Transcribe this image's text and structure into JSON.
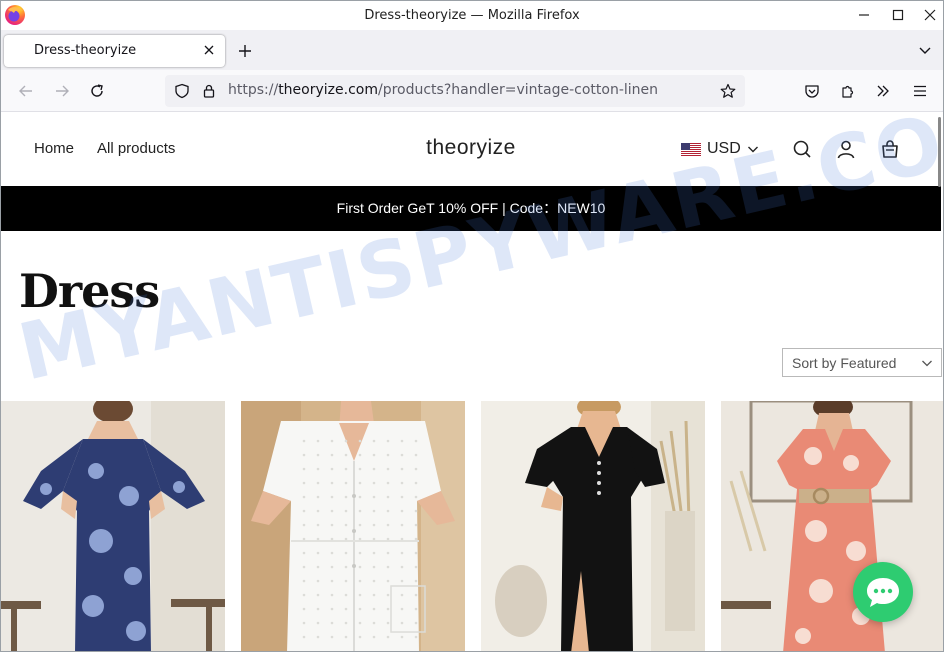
{
  "window": {
    "title": "Dress-theoryize — Mozilla Firefox"
  },
  "tab": {
    "title": "Dress-theoryize"
  },
  "urlbar": {
    "scheme": "https://",
    "host": "theoryize.com",
    "path": "/products?handler=vintage-cotton-linen"
  },
  "site": {
    "nav": [
      "Home",
      "All products"
    ],
    "logo": "theoryize",
    "currency": "USD",
    "announcement": "First Order GeT 10% OFF | Code：NEW10",
    "collection_title": "Dress",
    "sort_label": "Sort by",
    "sort_value": "Featured"
  },
  "products": [
    {
      "dress_color": "#2e3d73",
      "pattern_color": "#8ea2d3",
      "bg": "#ece9e3"
    },
    {
      "dress_color": "#f7f7f5",
      "pattern_color": "#dcdcd8",
      "bg": "#d4b48a"
    },
    {
      "dress_color": "#121212",
      "pattern_color": "#2a2a2a",
      "bg": "#f1eee7"
    },
    {
      "dress_color": "#e98a75",
      "pattern_color": "#f7ddd2",
      "bg": "#ece7df"
    }
  ],
  "watermark": "MYANTISPYWARE.COM",
  "colors": {
    "announcement_bg": "#000000",
    "chat_button": "#2ecc71",
    "firefox_tabstrip": "#f0f0f4"
  }
}
